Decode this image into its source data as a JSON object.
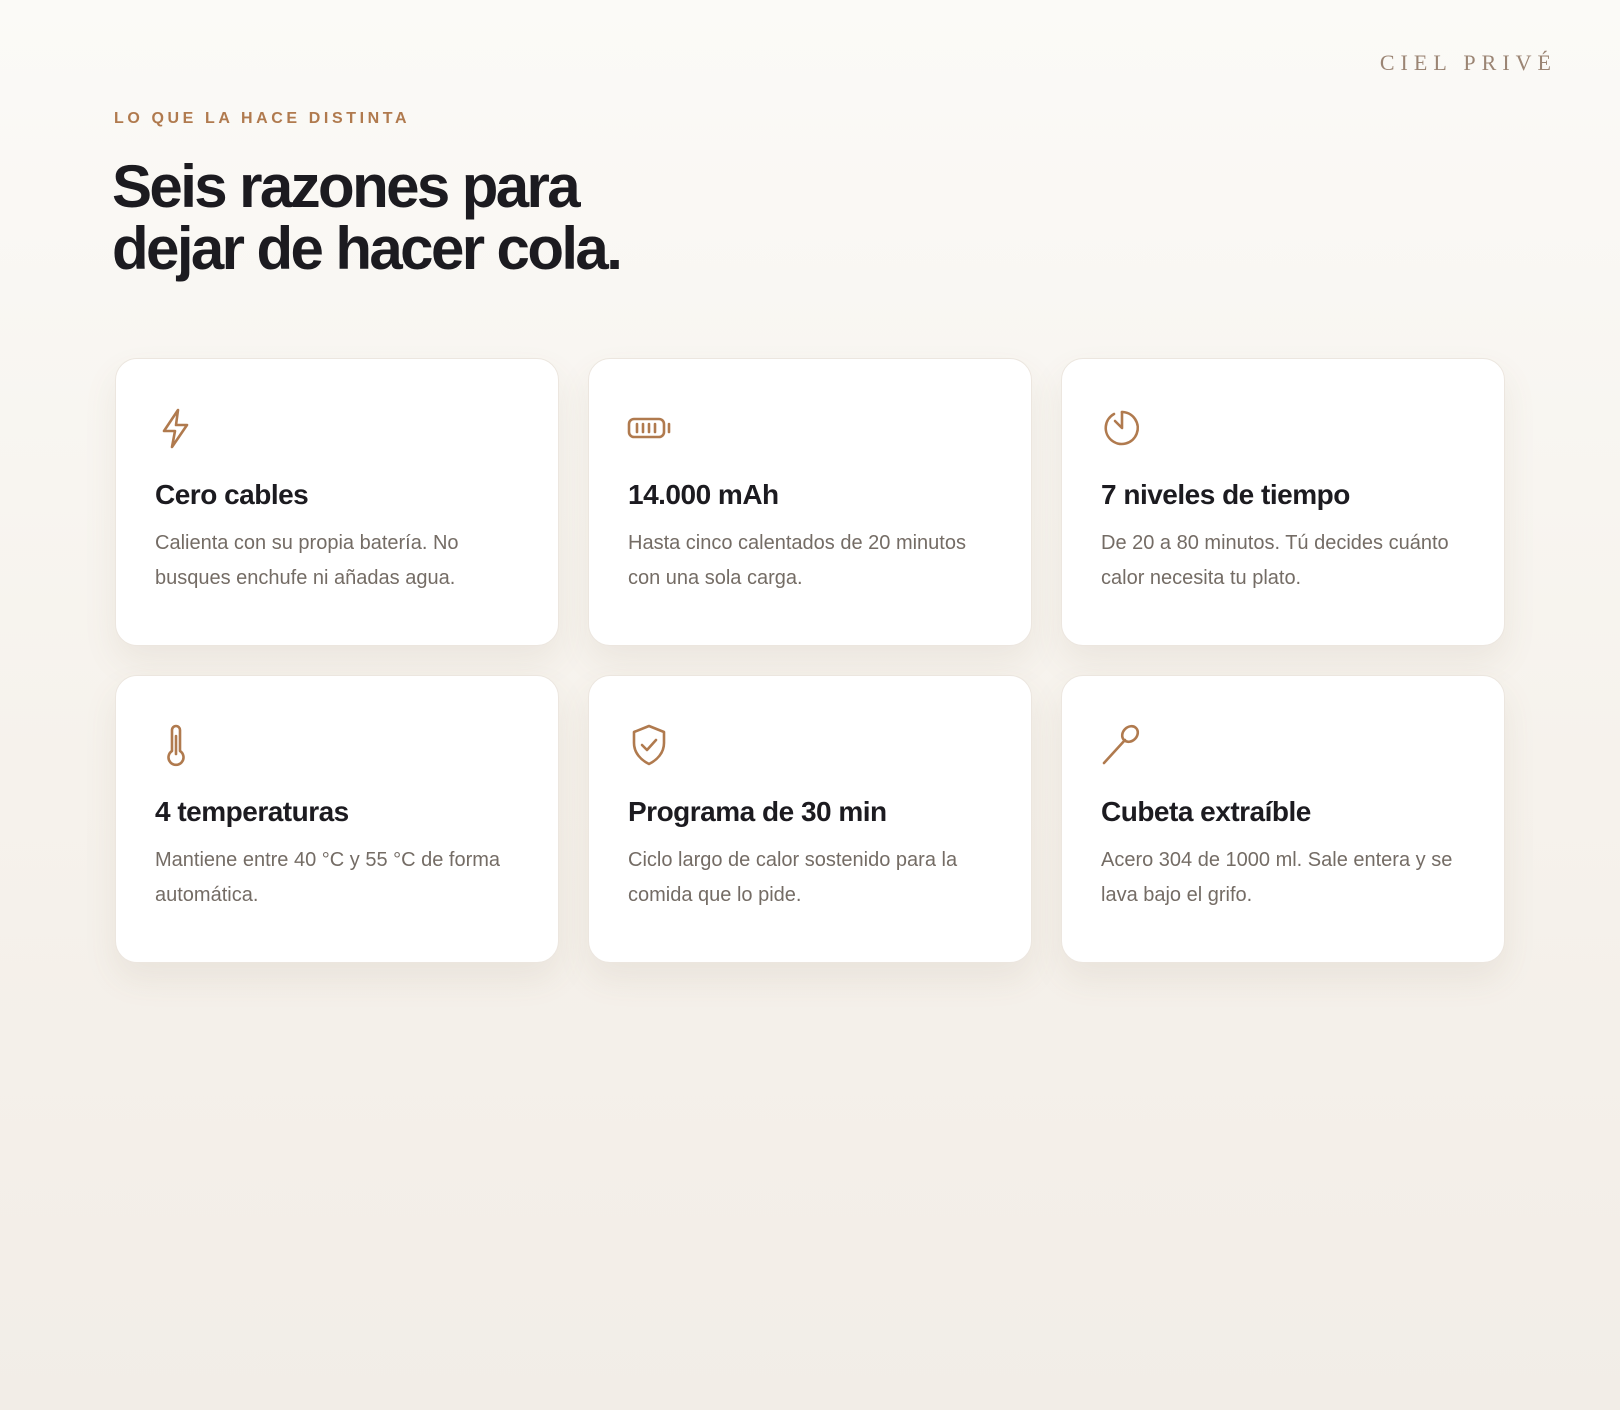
{
  "brand": "CIEL PRIVÉ",
  "eyebrow": "LO QUE LA HACE DISTINTA",
  "headline": {
    "line1": "Seis razones para",
    "line2": "dejar de hacer cola."
  },
  "accent_color": "#b07a4e",
  "features": [
    {
      "icon": "lightning-icon",
      "title": "Cero cables",
      "text": "Calienta con su propia batería. No busques enchufe ni añadas agua."
    },
    {
      "icon": "battery-icon",
      "title": "14.000 mAh",
      "text": "Hasta cinco calentados de 20 minutos con una sola carga."
    },
    {
      "icon": "timer-icon",
      "title": "7 niveles de tiempo",
      "text": "De 20 a 80 minutos. Tú decides cuánto calor necesita tu plato."
    },
    {
      "icon": "thermometer-icon",
      "title": "4 temperaturas",
      "text": "Mantiene entre 40 °C y 55 °C de forma automática."
    },
    {
      "icon": "shield-check-icon",
      "title": "Programa de 30 min",
      "text": "Ciclo largo de calor sostenido para la comida que lo pide."
    },
    {
      "icon": "spoon-icon",
      "title": "Cubeta extraíble",
      "text": "Acero 304 de 1000 ml. Sale entera y se lava bajo el grifo."
    }
  ]
}
